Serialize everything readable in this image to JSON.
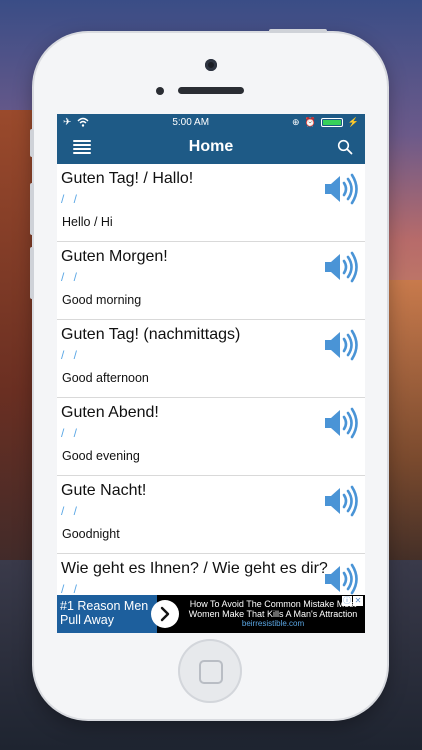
{
  "status": {
    "time": "5:00 AM"
  },
  "nav": {
    "title": "Home"
  },
  "phrases": [
    {
      "phrase": "Guten Tag! / Hallo!",
      "pronunciation": "/ /",
      "translation": "Hello / Hi"
    },
    {
      "phrase": "Guten Morgen!",
      "pronunciation": "/ /",
      "translation": "Good morning"
    },
    {
      "phrase": "Guten Tag! (nachmittags)",
      "pronunciation": "/ /",
      "translation": "Good afternoon"
    },
    {
      "phrase": "Guten Abend!",
      "pronunciation": "/ /",
      "translation": "Good evening"
    },
    {
      "phrase": "Gute Nacht!",
      "pronunciation": "/ /",
      "translation": "Goodnight"
    },
    {
      "phrase": "Wie geht es Ihnen? / Wie geht es dir?",
      "pronunciation": "/ /",
      "translation": ""
    }
  ],
  "ad": {
    "headline": "#1 Reason Men Pull Away",
    "body": "How To Avoid The Common Mistake Most Women Make That Kills A Man's Attraction",
    "url": "beirresistible.com"
  },
  "colors": {
    "nav_bg": "#1e5a86",
    "accent": "#5ba7e5",
    "ad_left_bg": "#1d5f9d"
  },
  "icons": {
    "hamburger": "hamburger-icon",
    "search": "search-icon",
    "speaker": "speaker-icon",
    "ad_arrow": "chevron-right-icon"
  }
}
